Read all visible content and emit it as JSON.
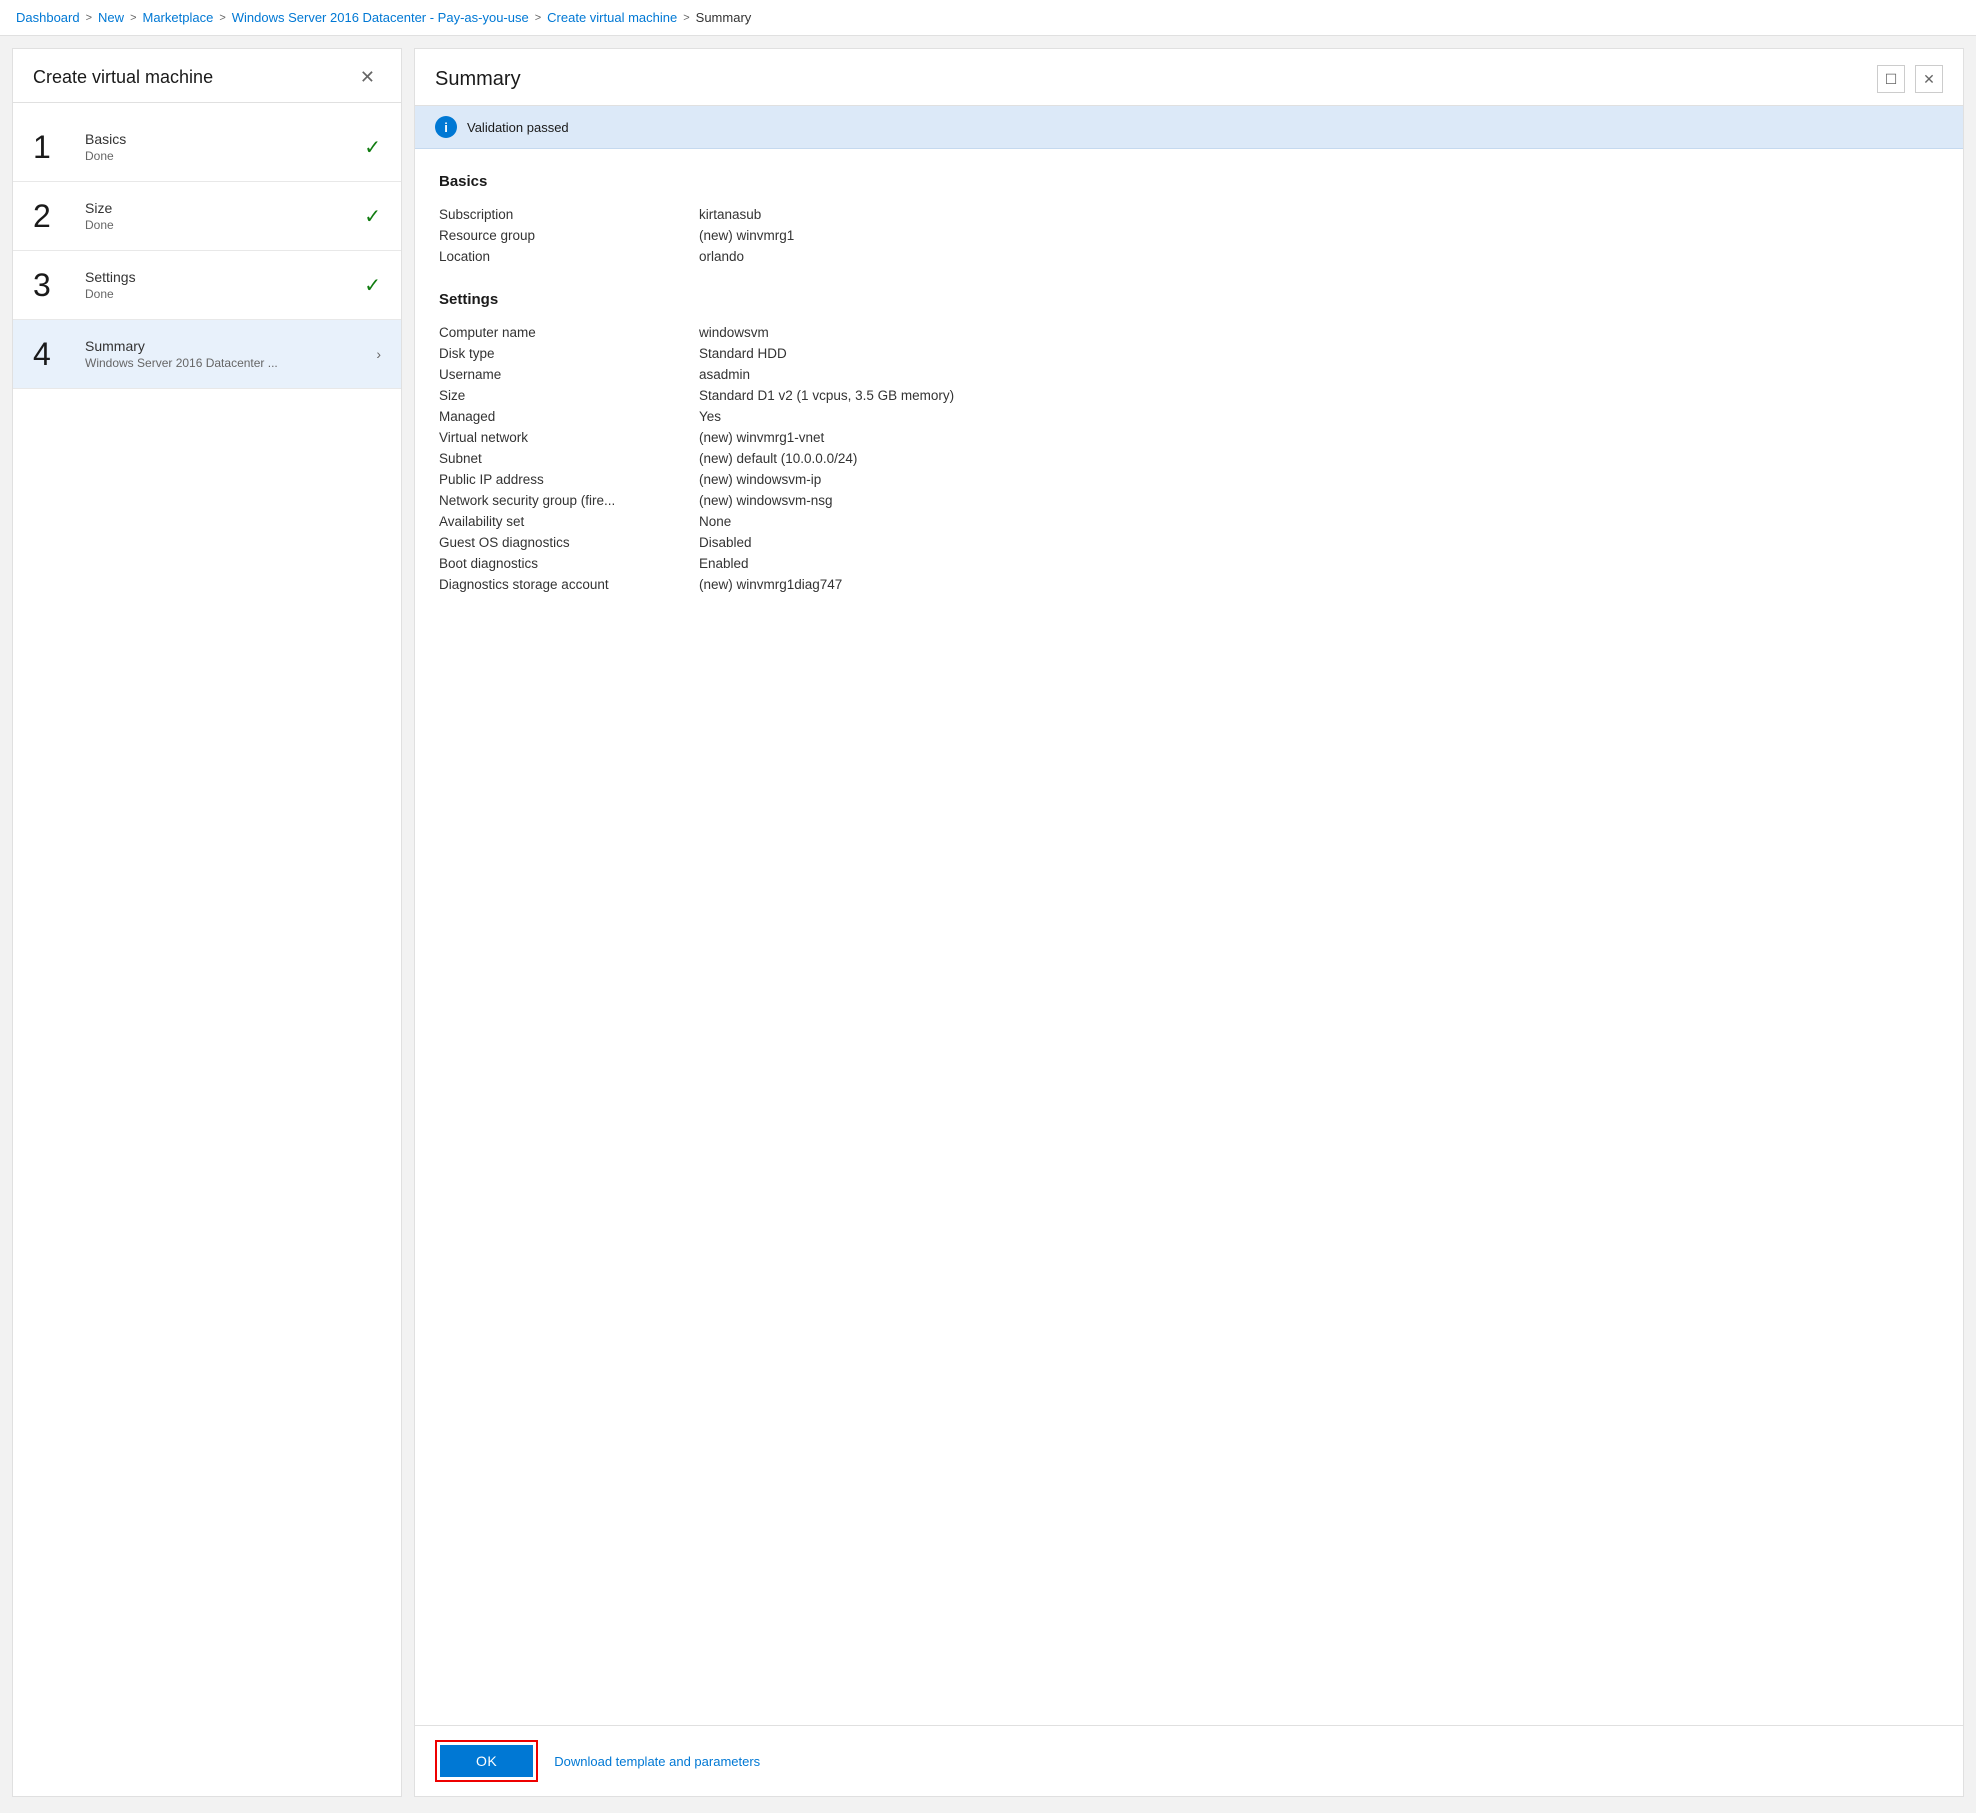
{
  "breadcrumb": {
    "items": [
      {
        "label": "Dashboard",
        "link": true
      },
      {
        "label": "New",
        "link": true
      },
      {
        "label": "Marketplace",
        "link": true
      },
      {
        "label": "Windows Server 2016 Datacenter - Pay-as-you-use",
        "link": true
      },
      {
        "label": "Create virtual machine",
        "link": true
      },
      {
        "label": "Summary",
        "link": false
      }
    ],
    "separator": ">"
  },
  "left_panel": {
    "title": "Create virtual machine",
    "close_icon": "✕",
    "steps": [
      {
        "number": "1",
        "name": "Basics",
        "status": "Done",
        "check": true,
        "active": false,
        "subtitle": ""
      },
      {
        "number": "2",
        "name": "Size",
        "status": "Done",
        "check": true,
        "active": false,
        "subtitle": ""
      },
      {
        "number": "3",
        "name": "Settings",
        "status": "Done",
        "check": true,
        "active": false,
        "subtitle": ""
      },
      {
        "number": "4",
        "name": "Summary",
        "status": "Windows Server 2016 Datacenter ...",
        "check": false,
        "active": true,
        "subtitle": "Windows Server 2016 Datacenter ..."
      }
    ]
  },
  "right_panel": {
    "title": "Summary",
    "restore_icon": "☐",
    "close_icon": "✕",
    "validation": {
      "icon": "i",
      "text": "Validation passed"
    },
    "sections": [
      {
        "title": "Basics",
        "rows": [
          {
            "label": "Subscription",
            "value": "kirtanasub"
          },
          {
            "label": "Resource group",
            "value": "(new) winvmrg1"
          },
          {
            "label": "Location",
            "value": "orlando"
          }
        ]
      },
      {
        "title": "Settings",
        "rows": [
          {
            "label": "Computer name",
            "value": "windowsvm"
          },
          {
            "label": "Disk type",
            "value": "Standard HDD"
          },
          {
            "label": "Username",
            "value": "asadmin"
          },
          {
            "label": "Size",
            "value": "Standard D1 v2 (1 vcpus, 3.5 GB memory)"
          },
          {
            "label": "Managed",
            "value": "Yes"
          },
          {
            "label": "Virtual network",
            "value": "(new) winvmrg1-vnet"
          },
          {
            "label": "Subnet",
            "value": "(new) default (10.0.0.0/24)"
          },
          {
            "label": "Public IP address",
            "value": "(new) windowsvm-ip"
          },
          {
            "label": "Network security group (fire...",
            "value": "(new) windowsvm-nsg"
          },
          {
            "label": "Availability set",
            "value": "None"
          },
          {
            "label": "Guest OS diagnostics",
            "value": "Disabled"
          },
          {
            "label": "Boot diagnostics",
            "value": "Enabled"
          },
          {
            "label": "Diagnostics storage account",
            "value": "(new) winvmrg1diag747"
          }
        ]
      }
    ],
    "footer": {
      "ok_label": "OK",
      "download_label": "Download template and parameters"
    }
  }
}
